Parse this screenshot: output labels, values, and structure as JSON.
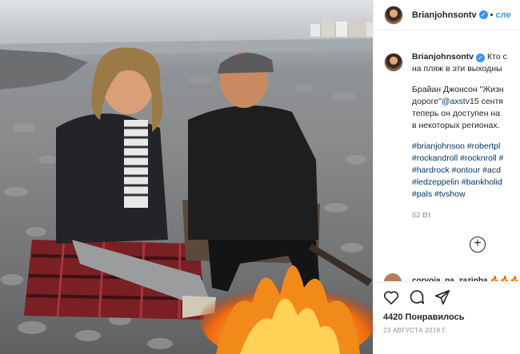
{
  "post": {
    "username": "Brianjohnsontv",
    "follow_label": "сле",
    "header_dot": "•",
    "caption_line1": "Кто с",
    "caption_line2": "на пляж в эти выходны",
    "para2_line1": "Брайан Джонсон \"Жизн",
    "para2_line2a": "дороге\"",
    "para2_mention": "@axstv",
    "para2_line2b": "15 сентя",
    "para2_line3": "теперь он доступен на",
    "para2_line4": "в некоторых регионах.",
    "hashtags": [
      "#brianjohnson #robertpl",
      "#rockandroll #rocknroll #",
      "#hardrock #ontour #acd",
      "#ledzeppelin #bankholid",
      "#pals #tvshow"
    ],
    "comment_age": "62 Вт",
    "load_more_symbol": "+",
    "next_comment_user": "corvoia_na_zazinha",
    "next_comment_emoji": "🔥🔥🔥",
    "likes_text": "4420 Понравилось",
    "date_text": "23 АВГУСТА 2019 Г.",
    "verified_mark": "✓"
  },
  "icons": [
    "heart-icon",
    "comment-icon",
    "share-icon"
  ],
  "colors": {
    "link": "#003569",
    "accent": "#3897f0",
    "muted": "#8e8e8e"
  }
}
